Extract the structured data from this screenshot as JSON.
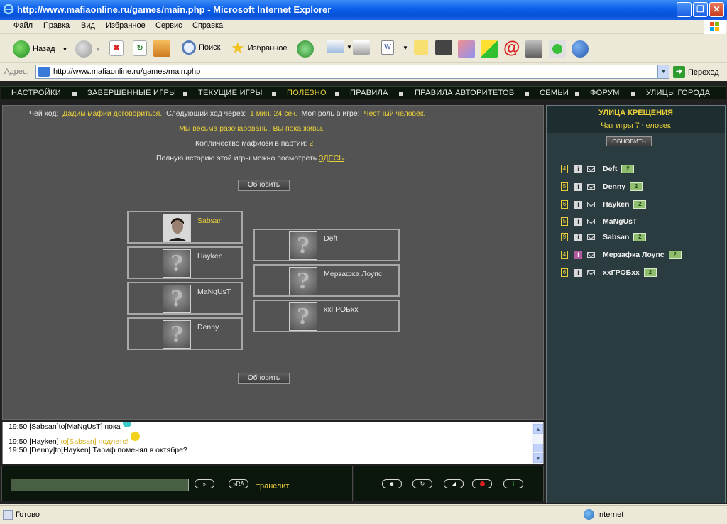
{
  "window": {
    "title": "http://www.mafiaonline.ru/games/main.php - Microsoft Internet Explorer"
  },
  "menu": [
    "Файл",
    "Правка",
    "Вид",
    "Избранное",
    "Сервис",
    "Справка"
  ],
  "toolbar": {
    "back": "Назад",
    "search": "Поиск",
    "favorites": "Избранное"
  },
  "address": {
    "label": "Адрес:",
    "url": "http://www.mafiaonline.ru/games/main.php",
    "go": "Переход"
  },
  "nav": [
    "НАСТРОЙКИ",
    "ЗАВЕРШЕННЫЕ ИГРЫ",
    "ТЕКУЩИЕ ИГРЫ",
    "ПОЛЕЗНО",
    "ПРАВИЛА",
    "ПРАВИЛА АВТОРИТЕТОВ",
    "СЕМЬИ",
    "ФОРУМ",
    "УЛИЦЫ ГОРОДА"
  ],
  "game": {
    "turn_label": "Чей ход:",
    "turn_value": "Дадим мафии договориться.",
    "next_label": "Следующий ход через:",
    "next_value": "1 мин. 24 сек.",
    "role_label": "Моя роль в игре:",
    "role_value": "Честный человек.",
    "status_msg": "Мы весьма разочарованы, Вы пока живы.",
    "mafia_label": "Колличество мафиози в партии:",
    "mafia_count": "2",
    "history_text": "Полную историю этой игры можно посмотреть",
    "history_link": "ЗДЕСЬ",
    "history_end": ".",
    "refresh": "Обновить",
    "players_left": [
      "Sabsan",
      "Hayken",
      "MaNgUsT",
      "Denny"
    ],
    "players_right": [
      "Deft",
      "Мерзафка Лоупс",
      "xxГРОБxx"
    ]
  },
  "chat": {
    "messages": [
      {
        "time": "19:50",
        "from": "[Sabsan]",
        "to": "to[MaNgUsT]",
        "text": "пока"
      },
      {
        "time": "19:50",
        "from": "[Hayken]",
        "to": "to[Sabsan]",
        "text": "подлетс!"
      },
      {
        "time": "19:50",
        "from": "[Denny]",
        "to": "to[Hayken]",
        "text": "Тариф поменял в октябре?"
      }
    ],
    "send1": "»",
    "send2": "»RA",
    "translit": "транслит"
  },
  "sidebar": {
    "street": "УЛИЦА КРЕЩЕНИЯ",
    "chat_count": "Чат игры 7 человек",
    "refresh": "ОБНОВИТЬ",
    "users": [
      {
        "level": "4",
        "name": "Deft",
        "money": "2"
      },
      {
        "level": "5",
        "name": "Denny",
        "money": "2"
      },
      {
        "level": "6",
        "name": "Hayken",
        "money": "2"
      },
      {
        "level": "5",
        "name": "MaNgUsT",
        "money": ""
      },
      {
        "level": "9",
        "name": "Sabsan",
        "money": "2"
      },
      {
        "level": "4",
        "name": "Мерзафка Лоупс",
        "money": "2"
      },
      {
        "level": "6",
        "name": "xxГРОБxx",
        "money": "2"
      }
    ]
  },
  "status": {
    "text": "Готово",
    "zone": "Internet"
  }
}
